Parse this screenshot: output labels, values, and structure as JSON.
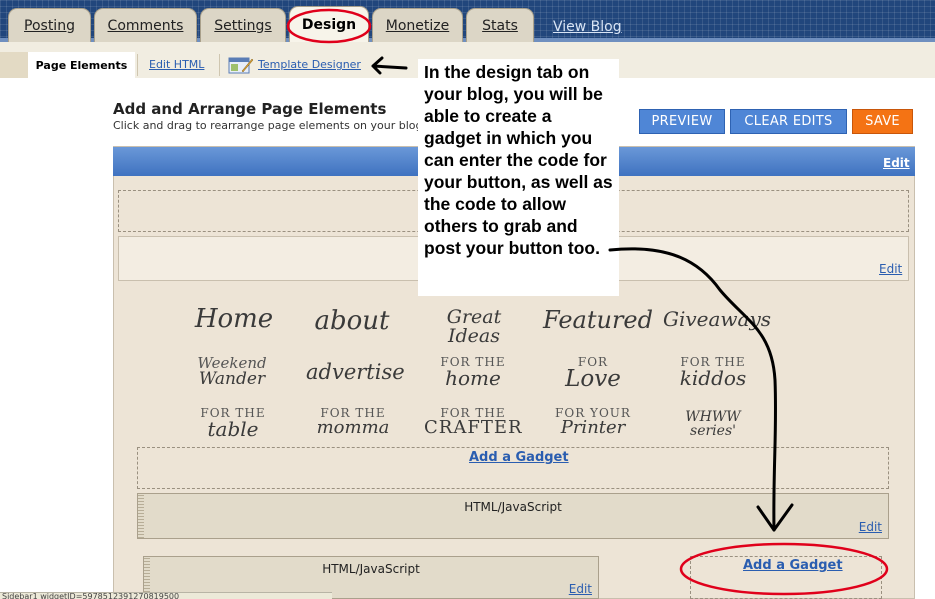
{
  "tabs": [
    {
      "label": "Posting"
    },
    {
      "label": "Comments"
    },
    {
      "label": "Settings"
    },
    {
      "label": "Design"
    },
    {
      "label": "Monetize"
    },
    {
      "label": "Stats"
    }
  ],
  "view_blog": "View Blog",
  "subnav": {
    "active": "Page Elements",
    "edit_html": "Edit HTML",
    "template_designer": "Template Designer"
  },
  "page": {
    "title": "Add and Arrange Page Elements",
    "subtitle": "Click and drag to rearrange page elements on your blog."
  },
  "buttons": {
    "preview": "PREVIEW",
    "clear": "CLEAR EDITS",
    "save": "SAVE"
  },
  "layout": {
    "edit": "Edit",
    "add_gadget": "Add a Gadget",
    "gadget_title": "HTML/JavaScript"
  },
  "nav_graphics": [
    {
      "small": "",
      "big": "Home"
    },
    {
      "small": "",
      "big": "about"
    },
    {
      "small": "",
      "big": "Great Ideas"
    },
    {
      "small": "",
      "big": "Featured"
    },
    {
      "small": "",
      "big": "Giveaways"
    },
    {
      "small": "Weekend",
      "big": "Wander"
    },
    {
      "small": "",
      "big": "advertise"
    },
    {
      "small": "FOR THE",
      "big": "home"
    },
    {
      "small": "FOR",
      "big": "Love"
    },
    {
      "small": "FOR THE",
      "big": "kiddos"
    },
    {
      "small": "FOR THE",
      "big": "table"
    },
    {
      "small": "FOR THE",
      "big": "momma"
    },
    {
      "small": "FOR THE",
      "big": "CRAFTER"
    },
    {
      "small": "FOR YOUR",
      "big": "Printer"
    },
    {
      "small": "WHWW",
      "big": "series'"
    }
  ],
  "callout": "In the design tab on your blog, you will be able to create a gadget in which you can enter the code for your button, as well as the code to allow others to grab and post your button too.",
  "statusbar": "Sidebar1 widgetID=5978512391270819500",
  "colors": {
    "annotation": "#e0001b",
    "accent_blue": "#4f86d6",
    "save_orange": "#f47314"
  }
}
